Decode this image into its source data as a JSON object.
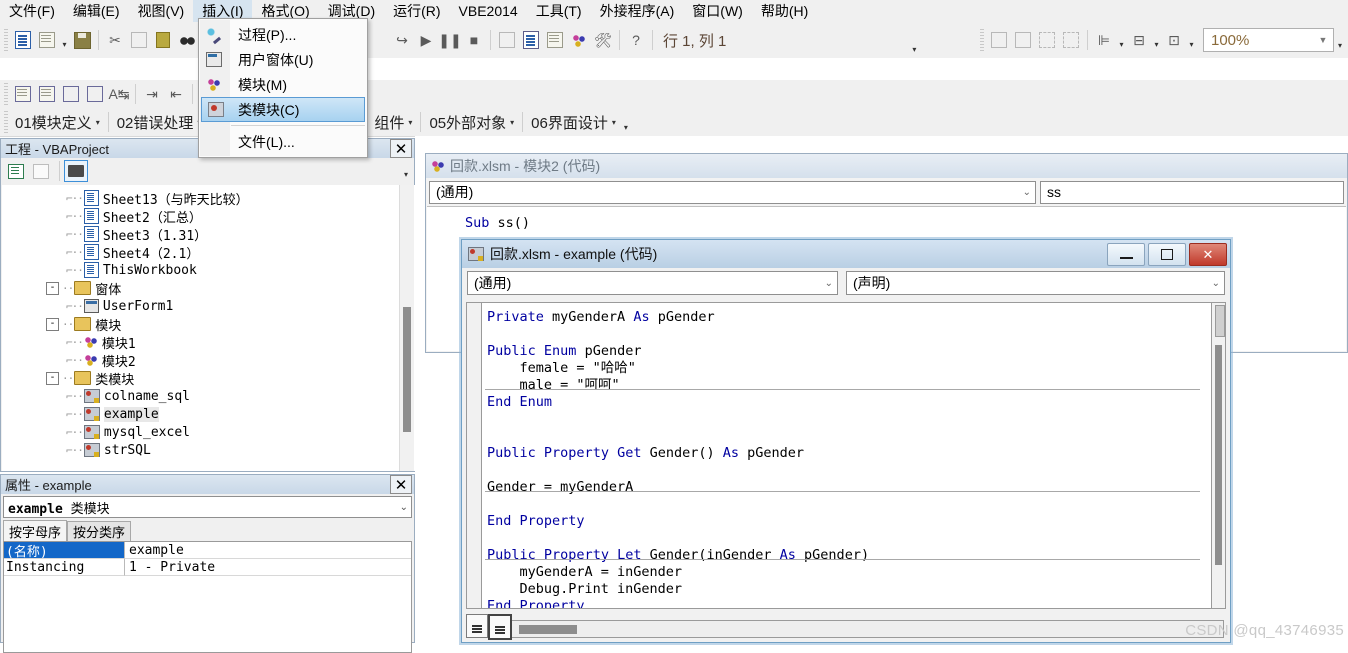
{
  "menubar": {
    "items": [
      {
        "label": "文件(F)",
        "active": false
      },
      {
        "label": "编辑(E)",
        "active": false
      },
      {
        "label": "视图(V)",
        "active": false
      },
      {
        "label": "插入(I)",
        "active": true
      },
      {
        "label": "格式(O)",
        "active": false
      },
      {
        "label": "调试(D)",
        "active": false
      },
      {
        "label": "运行(R)",
        "active": false
      },
      {
        "label": "VBE2014",
        "active": false
      },
      {
        "label": "工具(T)",
        "active": false
      },
      {
        "label": "外接程序(A)",
        "active": false
      },
      {
        "label": "窗口(W)",
        "active": false
      },
      {
        "label": "帮助(H)",
        "active": false
      }
    ]
  },
  "insert_menu": {
    "items": [
      {
        "label": "过程(P)...",
        "icon": "insert-procedure-icon",
        "selected": false
      },
      {
        "label": "用户窗体(U)",
        "icon": "insert-userform-icon",
        "selected": false
      },
      {
        "label": "模块(M)",
        "icon": "insert-module-icon",
        "selected": false
      },
      {
        "label": "类模块(C)",
        "icon": "insert-class-module-icon",
        "selected": true
      },
      {
        "label": "文件(L)...",
        "icon": "insert-file-icon",
        "selected": false
      }
    ]
  },
  "toolbar": {
    "position_label": "行 1, 列 1",
    "zoom_value": "100%",
    "icons": [
      "view-excel-icon",
      "insert-object-icon",
      "save-icon",
      "cut-icon",
      "copy-icon",
      "paste-icon",
      "find-icon",
      "undo-icon",
      "redo-icon",
      "run-icon",
      "break-icon",
      "reset-icon",
      "design-mode-icon",
      "project-explorer-icon",
      "properties-window-icon",
      "object-browser-icon",
      "toolbox-icon",
      "help-icon"
    ],
    "row2_icons": [
      "list-properties-icon",
      "list-constants-icon",
      "quick-info-icon",
      "parameter-info-icon",
      "complete-word-icon",
      "indent-icon",
      "outdent-icon",
      "hand-icon",
      "bring-front-icon",
      "send-back-icon",
      "group-icon",
      "ungroup-icon",
      "align-left-icon",
      "center-icon",
      "size-icon"
    ],
    "dropdowns": [
      {
        "label": "01模块定义"
      },
      {
        "label": "02错误处理"
      },
      {
        "label": "组件"
      },
      {
        "label": "05外部对象"
      },
      {
        "label": "06界面设计"
      }
    ]
  },
  "project_explorer": {
    "title": "工程 - VBAProject",
    "close_label": "✕",
    "toolbar_icons": [
      "view-code-icon",
      "view-object-icon",
      "toggle-folders-icon"
    ],
    "tree": [
      {
        "depth": 2,
        "icon": "sheet-icon",
        "label": "Sheet13（与昨天比较）",
        "expander": "",
        "selected": false
      },
      {
        "depth": 2,
        "icon": "sheet-icon",
        "label": "Sheet2（汇总）",
        "expander": "",
        "selected": false
      },
      {
        "depth": 2,
        "icon": "sheet-icon",
        "label": "Sheet3（1.31）",
        "expander": "",
        "selected": false
      },
      {
        "depth": 2,
        "icon": "sheet-icon",
        "label": "Sheet4（2.1）",
        "expander": "",
        "selected": false
      },
      {
        "depth": 2,
        "icon": "sheet-icon",
        "label": "ThisWorkbook",
        "expander": "",
        "selected": false
      },
      {
        "depth": 1,
        "icon": "folder-icon",
        "label": "窗体",
        "expander": "-",
        "selected": false
      },
      {
        "depth": 2,
        "icon": "userform-icon",
        "label": "UserForm1",
        "expander": "",
        "selected": false
      },
      {
        "depth": 1,
        "icon": "folder-icon",
        "label": "模块",
        "expander": "-",
        "selected": false
      },
      {
        "depth": 2,
        "icon": "module-icon",
        "label": "模块1",
        "expander": "",
        "selected": false
      },
      {
        "depth": 2,
        "icon": "module-icon",
        "label": "模块2",
        "expander": "",
        "selected": false
      },
      {
        "depth": 1,
        "icon": "folder-icon",
        "label": "类模块",
        "expander": "-",
        "selected": false
      },
      {
        "depth": 2,
        "icon": "class-module-icon",
        "label": "colname_sql",
        "expander": "",
        "selected": false
      },
      {
        "depth": 2,
        "icon": "class-module-icon",
        "label": "example",
        "expander": "",
        "selected": true
      },
      {
        "depth": 2,
        "icon": "class-module-icon",
        "label": "mysql_excel",
        "expander": "",
        "selected": false
      },
      {
        "depth": 2,
        "icon": "class-module-icon",
        "label": "strSQL",
        "expander": "",
        "selected": false
      }
    ]
  },
  "properties_panel": {
    "title": "属性 - example",
    "close_label": "✕",
    "object_name": "example",
    "object_type": "类模块",
    "tabs": [
      {
        "label": "按字母序",
        "active": true
      },
      {
        "label": "按分类序",
        "active": false
      }
    ],
    "rows": [
      {
        "key": "(名称)",
        "value": "example",
        "selected": true
      },
      {
        "key": "Instancing",
        "value": "1 - Private",
        "selected": false
      }
    ]
  },
  "code_window_module2": {
    "title": "回款.xlsm - 模块2 (代码)",
    "icon": "module-icon",
    "object_combo": "(通用)",
    "proc_combo": "ss",
    "code_lines": [
      {
        "text": "Sub ss()",
        "kw": "Sub"
      }
    ]
  },
  "code_window_example": {
    "title": "回款.xlsm - example (代码)",
    "icon": "class-module-icon",
    "object_combo": "(通用)",
    "proc_combo": "(声明)",
    "buttons": {
      "minimize": "minimize-button",
      "maximize": "maximize-button",
      "close": "close-button"
    },
    "code": [
      "Private myGenderA As pGender",
      "",
      "Public Enum pGender",
      "    female = \"哈哈\"",
      "    male = \"呵呵\"",
      "End Enum",
      "",
      "",
      "Public Property Get Gender() As pGender",
      "",
      "Gender = myGenderA",
      "",
      "End Property",
      "",
      "Public Property Let Gender(inGender As pGender)",
      "    myGenderA = inGender",
      "    Debug.Print inGender",
      "End Property"
    ],
    "view_buttons": [
      "procedure-view-icon",
      "full-module-view-icon"
    ]
  },
  "watermark": {
    "text": "CSDN @qq_43746935"
  }
}
